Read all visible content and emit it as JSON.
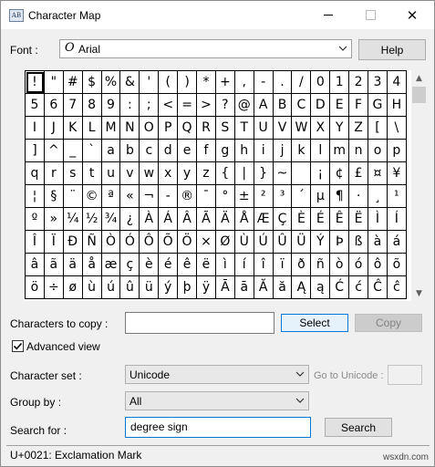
{
  "window": {
    "title": "Character Map",
    "icon": "charmap-app-icon",
    "icon_text": "AB",
    "controls": {
      "minimize": "minimize-icon",
      "maximize": "maximize-icon",
      "close": "✕"
    }
  },
  "font_row": {
    "label": "Font :",
    "font_glyph": "O",
    "selected": "Arial",
    "help_label": "Help"
  },
  "grid": {
    "columns": 20,
    "selected_index": 0,
    "rows": [
      [
        "!",
        "\"",
        "#",
        "$",
        "%",
        "&",
        "'",
        "(",
        ")",
        "*",
        "+",
        ",",
        "-",
        ".",
        "/",
        "0",
        "1",
        "2",
        "3",
        "4"
      ],
      [
        "5",
        "6",
        "7",
        "8",
        "9",
        ":",
        ";",
        "<",
        "=",
        ">",
        "?",
        "@",
        "A",
        "B",
        "C",
        "D",
        "E",
        "F",
        "G",
        "H"
      ],
      [
        "I",
        "J",
        "K",
        "L",
        "M",
        "N",
        "O",
        "P",
        "Q",
        "R",
        "S",
        "T",
        "U",
        "V",
        "W",
        "X",
        "Y",
        "Z",
        "[",
        "\\"
      ],
      [
        "]",
        "^",
        "_",
        "`",
        "a",
        "b",
        "c",
        "d",
        "e",
        "f",
        "g",
        "h",
        "i",
        "j",
        "k",
        "l",
        "m",
        "n",
        "o",
        "p"
      ],
      [
        "q",
        "r",
        "s",
        "t",
        "u",
        "v",
        "w",
        "x",
        "y",
        "z",
        "{",
        "|",
        "}",
        "~",
        "",
        "¡",
        "¢",
        "£",
        "¤",
        "¥"
      ],
      [
        "¦",
        "§",
        "¨",
        "©",
        "ª",
        "«",
        "¬",
        "-",
        "®",
        "¯",
        "°",
        "±",
        "²",
        "³",
        "´",
        "µ",
        "¶",
        "·",
        "¸",
        "¹"
      ],
      [
        "º",
        "»",
        "¼",
        "½",
        "¾",
        "¿",
        "À",
        "Á",
        "Â",
        "Ã",
        "Ä",
        "Å",
        "Æ",
        "Ç",
        "È",
        "É",
        "Ê",
        "Ë",
        "Ì",
        "Í"
      ],
      [
        "Î",
        "Ï",
        "Ð",
        "Ñ",
        "Ò",
        "Ó",
        "Ô",
        "Õ",
        "Ö",
        "×",
        "Ø",
        "Ù",
        "Ú",
        "Û",
        "Ü",
        "Ý",
        "Þ",
        "ß",
        "à",
        "á"
      ],
      [
        "â",
        "ã",
        "ä",
        "å",
        "æ",
        "ç",
        "è",
        "é",
        "ê",
        "ë",
        "ì",
        "í",
        "î",
        "ï",
        "ð",
        "ñ",
        "ò",
        "ó",
        "ô",
        "õ"
      ],
      [
        "ö",
        "÷",
        "ø",
        "ù",
        "ú",
        "û",
        "ü",
        "ý",
        "þ",
        "ÿ",
        "Ā",
        "ā",
        "Ă",
        "ă",
        "Ą",
        "ą",
        "Ć",
        "ć",
        "Ĉ",
        "ĉ"
      ]
    ]
  },
  "copy_row": {
    "label": "Characters to copy :",
    "value": "",
    "select_label": "Select",
    "copy_label": "Copy"
  },
  "advanced": {
    "label": "Advanced view",
    "checked": true
  },
  "charset_row": {
    "label": "Character set :",
    "selected": "Unicode",
    "goto_label": "Go to Unicode :",
    "goto_value": ""
  },
  "groupby_row": {
    "label": "Group by :",
    "selected": "All"
  },
  "search_row": {
    "label": "Search for :",
    "value": "degree sign",
    "button_label": "Search"
  },
  "status": {
    "text": "U+0021: Exclamation Mark"
  },
  "watermark": "wsxdn.com"
}
